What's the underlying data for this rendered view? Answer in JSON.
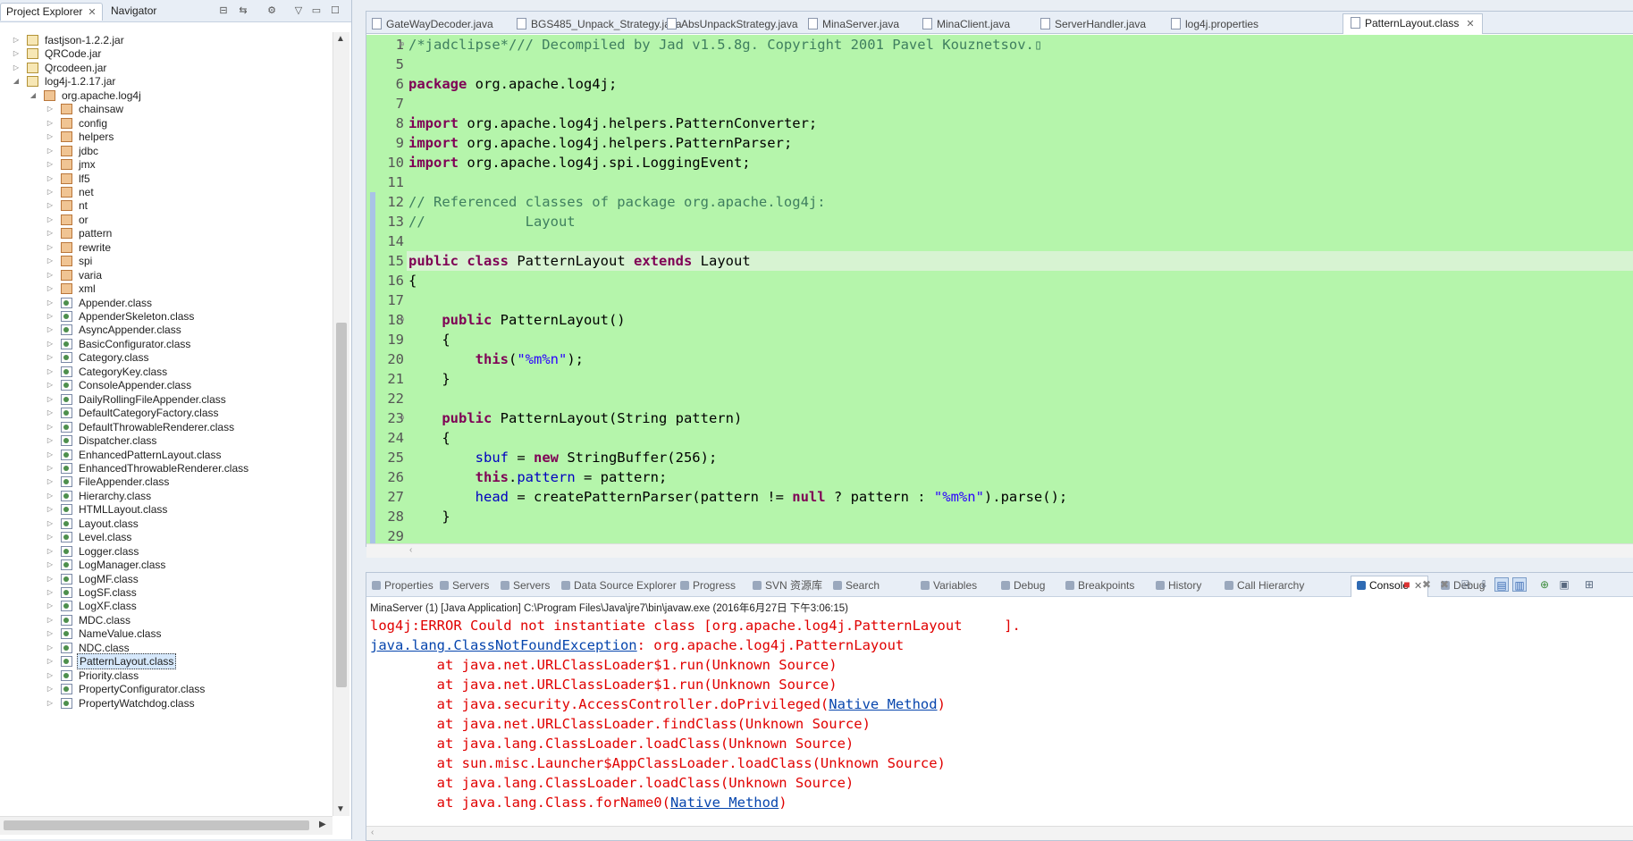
{
  "left_panel": {
    "tab_project_explorer": "Project Explorer",
    "tab_navigator": "Navigator",
    "tree": [
      {
        "label": "fastjson-1.2.2.jar",
        "type": "jar",
        "expanded": false,
        "level": 0
      },
      {
        "label": "QRCode.jar",
        "type": "jar",
        "expanded": false,
        "level": 0
      },
      {
        "label": "Qrcodeen.jar",
        "type": "jar",
        "expanded": false,
        "level": 0
      },
      {
        "label": "log4j-1.2.17.jar",
        "type": "jar",
        "expanded": true,
        "level": 0
      },
      {
        "label": "org.apache.log4j",
        "type": "pkg",
        "expanded": true,
        "level": 1
      },
      {
        "label": "chainsaw",
        "type": "pkg",
        "level": 2
      },
      {
        "label": "config",
        "type": "pkg",
        "level": 2
      },
      {
        "label": "helpers",
        "type": "pkg",
        "level": 2
      },
      {
        "label": "jdbc",
        "type": "pkg",
        "level": 2
      },
      {
        "label": "jmx",
        "type": "pkg",
        "level": 2
      },
      {
        "label": "lf5",
        "type": "pkg",
        "level": 2
      },
      {
        "label": "net",
        "type": "pkg",
        "level": 2
      },
      {
        "label": "nt",
        "type": "pkg",
        "level": 2
      },
      {
        "label": "or",
        "type": "pkg",
        "level": 2
      },
      {
        "label": "pattern",
        "type": "pkg",
        "level": 2
      },
      {
        "label": "rewrite",
        "type": "pkg",
        "level": 2
      },
      {
        "label": "spi",
        "type": "pkg",
        "level": 2
      },
      {
        "label": "varia",
        "type": "pkg",
        "level": 2
      },
      {
        "label": "xml",
        "type": "pkg",
        "level": 2
      },
      {
        "label": "Appender.class",
        "type": "cls",
        "level": 2
      },
      {
        "label": "AppenderSkeleton.class",
        "type": "cls",
        "level": 2
      },
      {
        "label": "AsyncAppender.class",
        "type": "cls",
        "level": 2
      },
      {
        "label": "BasicConfigurator.class",
        "type": "cls",
        "level": 2
      },
      {
        "label": "Category.class",
        "type": "cls",
        "level": 2
      },
      {
        "label": "CategoryKey.class",
        "type": "cls",
        "level": 2
      },
      {
        "label": "ConsoleAppender.class",
        "type": "cls",
        "level": 2
      },
      {
        "label": "DailyRollingFileAppender.class",
        "type": "cls",
        "level": 2
      },
      {
        "label": "DefaultCategoryFactory.class",
        "type": "cls",
        "level": 2
      },
      {
        "label": "DefaultThrowableRenderer.class",
        "type": "cls",
        "level": 2
      },
      {
        "label": "Dispatcher.class",
        "type": "cls",
        "level": 2
      },
      {
        "label": "EnhancedPatternLayout.class",
        "type": "cls",
        "level": 2
      },
      {
        "label": "EnhancedThrowableRenderer.class",
        "type": "cls",
        "level": 2
      },
      {
        "label": "FileAppender.class",
        "type": "cls",
        "level": 2
      },
      {
        "label": "Hierarchy.class",
        "type": "cls",
        "level": 2
      },
      {
        "label": "HTMLLayout.class",
        "type": "cls",
        "level": 2
      },
      {
        "label": "Layout.class",
        "type": "cls",
        "level": 2
      },
      {
        "label": "Level.class",
        "type": "cls",
        "level": 2
      },
      {
        "label": "Logger.class",
        "type": "cls",
        "level": 2
      },
      {
        "label": "LogManager.class",
        "type": "cls",
        "level": 2
      },
      {
        "label": "LogMF.class",
        "type": "cls",
        "level": 2
      },
      {
        "label": "LogSF.class",
        "type": "cls",
        "level": 2
      },
      {
        "label": "LogXF.class",
        "type": "cls",
        "level": 2
      },
      {
        "label": "MDC.class",
        "type": "cls",
        "level": 2
      },
      {
        "label": "NameValue.class",
        "type": "cls",
        "level": 2
      },
      {
        "label": "NDC.class",
        "type": "cls",
        "level": 2
      },
      {
        "label": "PatternLayout.class",
        "type": "cls",
        "level": 2,
        "selected": true
      },
      {
        "label": "Priority.class",
        "type": "cls",
        "level": 2
      },
      {
        "label": "PropertyConfigurator.class",
        "type": "cls",
        "level": 2
      },
      {
        "label": "PropertyWatchdog.class",
        "type": "cls",
        "level": 2
      }
    ]
  },
  "editor": {
    "tabs": [
      {
        "label": "GateWayDecoder.java"
      },
      {
        "label": "BGS485_Unpack_Strategy.java"
      },
      {
        "label": "AbsUnpackStrategy.java"
      },
      {
        "label": "MinaServer.java"
      },
      {
        "label": "MinaClient.java"
      },
      {
        "label": "ServerHandler.java"
      },
      {
        "label": "log4j.properties"
      },
      {
        "label": "PatternLayout.class",
        "active": true
      }
    ],
    "highlight_color": "#b5f5ab",
    "lines": [
      {
        "n": "1",
        "fold": "+",
        "tokens": [
          [
            "cm",
            "/*jadclipse*/// Decompiled by Jad v1.5.8g. Copyright 2001 Pavel Kouznetsov.▯"
          ]
        ]
      },
      {
        "n": "5",
        "tokens": []
      },
      {
        "n": "6",
        "tokens": [
          [
            "kw",
            "package"
          ],
          [
            "",
            " org.apache.log4j;"
          ]
        ]
      },
      {
        "n": "7",
        "tokens": []
      },
      {
        "n": "8",
        "tokens": [
          [
            "kw",
            "import"
          ],
          [
            "",
            " org.apache.log4j.helpers.PatternConverter;"
          ]
        ]
      },
      {
        "n": "9",
        "tokens": [
          [
            "kw",
            "import"
          ],
          [
            "",
            " org.apache.log4j.helpers.PatternParser;"
          ]
        ]
      },
      {
        "n": "10",
        "tokens": [
          [
            "kw",
            "import"
          ],
          [
            "",
            " org.apache.log4j.spi.LoggingEvent;"
          ]
        ]
      },
      {
        "n": "11",
        "tokens": []
      },
      {
        "n": "12",
        "tokens": [
          [
            "cm",
            "// Referenced classes of package org.apache.log4j:"
          ]
        ]
      },
      {
        "n": "13",
        "tokens": [
          [
            "cm",
            "//            Layout"
          ]
        ]
      },
      {
        "n": "14",
        "tokens": []
      },
      {
        "n": "15",
        "tokens": [
          [
            "kw",
            "public"
          ],
          [
            "",
            " "
          ],
          [
            "kw",
            "class"
          ],
          [
            "",
            " PatternLayout "
          ],
          [
            "kw",
            "extends"
          ],
          [
            "",
            " Layout"
          ]
        ]
      },
      {
        "n": "16",
        "tokens": [
          [
            "",
            "{"
          ]
        ]
      },
      {
        "n": "17",
        "tokens": []
      },
      {
        "n": "18",
        "fold": "−",
        "tokens": [
          [
            "",
            "    "
          ],
          [
            "kw",
            "public"
          ],
          [
            "",
            " PatternLayout()"
          ]
        ]
      },
      {
        "n": "19",
        "tokens": [
          [
            "",
            "    {"
          ]
        ]
      },
      {
        "n": "20",
        "tokens": [
          [
            "",
            "        "
          ],
          [
            "kw",
            "this"
          ],
          [
            "",
            "("
          ],
          [
            "st",
            "\"%m%n\""
          ],
          [
            "",
            ");"
          ]
        ]
      },
      {
        "n": "21",
        "tokens": [
          [
            "",
            "    }"
          ]
        ]
      },
      {
        "n": "22",
        "tokens": []
      },
      {
        "n": "23",
        "fold": "−",
        "tokens": [
          [
            "",
            "    "
          ],
          [
            "kw",
            "public"
          ],
          [
            "",
            " PatternLayout(String pattern)"
          ]
        ]
      },
      {
        "n": "24",
        "tokens": [
          [
            "",
            "    {"
          ]
        ]
      },
      {
        "n": "25",
        "tokens": [
          [
            "",
            "        "
          ],
          [
            "fd",
            "sbuf"
          ],
          [
            "",
            " = "
          ],
          [
            "kw",
            "new"
          ],
          [
            "",
            " StringBuffer(256);"
          ]
        ]
      },
      {
        "n": "26",
        "tokens": [
          [
            "",
            "        "
          ],
          [
            "kw",
            "this"
          ],
          [
            "",
            "."
          ],
          [
            "fd",
            "pattern"
          ],
          [
            "",
            " = pattern;"
          ]
        ]
      },
      {
        "n": "27",
        "tokens": [
          [
            "",
            "        "
          ],
          [
            "fd",
            "head"
          ],
          [
            "",
            " = createPatternParser(pattern != "
          ],
          [
            "kw",
            "null"
          ],
          [
            "",
            " ? pattern : "
          ],
          [
            "st",
            "\"%m%n\""
          ],
          [
            "",
            ").parse();"
          ]
        ]
      },
      {
        "n": "28",
        "tokens": [
          [
            "",
            "    }"
          ]
        ]
      },
      {
        "n": "29",
        "tokens": []
      }
    ]
  },
  "bottom_panel": {
    "tabs": [
      {
        "label": "Properties"
      },
      {
        "label": "Servers"
      },
      {
        "label": "Servers"
      },
      {
        "label": "Data Source Explorer"
      },
      {
        "label": "Progress"
      },
      {
        "label": "SVN 资源库"
      },
      {
        "label": "Search"
      },
      {
        "label": "Variables"
      },
      {
        "label": "Debug"
      },
      {
        "label": "Breakpoints"
      },
      {
        "label": "History"
      },
      {
        "label": "Call Hierarchy"
      },
      {
        "label": "Console",
        "active": true
      },
      {
        "label": "Debug"
      }
    ],
    "console_header": "MinaServer (1) [Java Application] C:\\Program Files\\Java\\jre7\\bin\\javaw.exe (2016年6月27日 下午3:06:15)",
    "console_lines": [
      [
        [
          "",
          "log4j:ERROR Could not instantiate class [org.apache.log4j.PatternLayout     ]."
        ]
      ],
      [
        [
          "link",
          "java.lang.ClassNotFoundException"
        ],
        [
          "",
          ": org.apache.log4j.PatternLayout"
        ]
      ],
      [
        [
          "",
          "\tat java.net.URLClassLoader$1.run(Unknown Source)"
        ]
      ],
      [
        [
          "",
          "\tat java.net.URLClassLoader$1.run(Unknown Source)"
        ]
      ],
      [
        [
          "",
          "\tat java.security.AccessController.doPrivileged("
        ],
        [
          "link",
          "Native Method"
        ],
        [
          "",
          ")"
        ]
      ],
      [
        [
          "",
          "\tat java.net.URLClassLoader.findClass(Unknown Source)"
        ]
      ],
      [
        [
          "",
          "\tat java.lang.ClassLoader.loadClass(Unknown Source)"
        ]
      ],
      [
        [
          "",
          "\tat sun.misc.Launcher$AppClassLoader.loadClass(Unknown Source)"
        ]
      ],
      [
        [
          "",
          "\tat java.lang.ClassLoader.loadClass(Unknown Source)"
        ]
      ],
      [
        [
          "",
          "\tat java.lang.Class.forName0("
        ],
        [
          "link",
          "Native Method"
        ],
        [
          "",
          ")"
        ]
      ]
    ]
  }
}
